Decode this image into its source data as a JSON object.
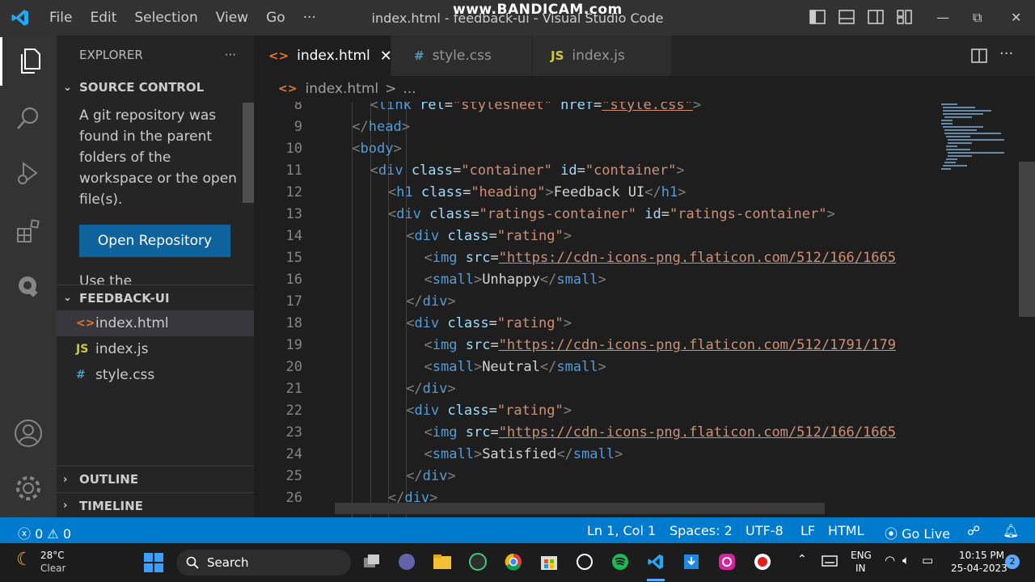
{
  "titlebar": {
    "menu": [
      "File",
      "Edit",
      "Selection",
      "View",
      "Go",
      "···"
    ],
    "title": "index.html - feedback-ui - Visual Studio Code",
    "watermark": "www.BANDICAM.com",
    "maximize": "⧉",
    "minimize": "—",
    "close": "✕"
  },
  "sidebar": {
    "header": "EXPLORER",
    "more": "···",
    "source_control": {
      "title": "SOURCE CONTROL",
      "message": "A git repository was found in the parent folders of the workspace or the open file(s).",
      "button": "Open Repository",
      "more_text": "Use the"
    },
    "folder": {
      "title": "FEEDBACK-UI",
      "files": [
        {
          "icon": "<>",
          "name": "index.html",
          "color": "#e37933"
        },
        {
          "icon": "JS",
          "name": "index.js",
          "color": "#cbcb41"
        },
        {
          "icon": "#",
          "name": "style.css",
          "color": "#519aba"
        }
      ]
    },
    "outline": "OUTLINE",
    "timeline": "TIMELINE"
  },
  "tabs": [
    {
      "icon": "<>",
      "label": "index.html",
      "active": true,
      "color": "#e37933"
    },
    {
      "icon": "#",
      "label": "style.css",
      "active": false,
      "color": "#519aba"
    },
    {
      "icon": "JS",
      "label": "index.js",
      "active": false,
      "color": "#cbcb41"
    }
  ],
  "breadcrumb": {
    "icon": "<>",
    "file": "index.html",
    "sep": ">",
    "rest": "..."
  },
  "code": {
    "lines": [
      {
        "n": "8",
        "indent": 2,
        "parts": [
          [
            "br",
            "<"
          ],
          [
            "tag",
            "link"
          ],
          [
            "txt",
            " "
          ],
          [
            "attr",
            "rel"
          ],
          [
            "txt",
            "="
          ],
          [
            "val",
            "\"stylesheet\""
          ],
          [
            "txt",
            " "
          ],
          [
            "attr",
            "href"
          ],
          [
            "txt",
            "="
          ],
          [
            "url",
            "\"style.css\""
          ],
          [
            "br",
            ">"
          ]
        ]
      },
      {
        "n": "9",
        "indent": 1,
        "parts": [
          [
            "br",
            "</"
          ],
          [
            "tag",
            "head"
          ],
          [
            "br",
            ">"
          ]
        ]
      },
      {
        "n": "10",
        "indent": 1,
        "parts": [
          [
            "br",
            "<"
          ],
          [
            "tag",
            "body"
          ],
          [
            "br",
            ">"
          ]
        ]
      },
      {
        "n": "11",
        "indent": 2,
        "parts": [
          [
            "br",
            "<"
          ],
          [
            "tag",
            "div"
          ],
          [
            "txt",
            " "
          ],
          [
            "attr",
            "class"
          ],
          [
            "txt",
            "="
          ],
          [
            "val",
            "\"container\""
          ],
          [
            "txt",
            " "
          ],
          [
            "attr",
            "id"
          ],
          [
            "txt",
            "="
          ],
          [
            "val",
            "\"container\""
          ],
          [
            "br",
            ">"
          ]
        ]
      },
      {
        "n": "12",
        "indent": 3,
        "parts": [
          [
            "br",
            "<"
          ],
          [
            "tag",
            "h1"
          ],
          [
            "txt",
            " "
          ],
          [
            "attr",
            "class"
          ],
          [
            "txt",
            "="
          ],
          [
            "val",
            "\"heading\""
          ],
          [
            "br",
            ">"
          ],
          [
            "txt",
            "Feedback UI"
          ],
          [
            "br",
            "</"
          ],
          [
            "tag",
            "h1"
          ],
          [
            "br",
            ">"
          ]
        ]
      },
      {
        "n": "13",
        "indent": 3,
        "parts": [
          [
            "br",
            "<"
          ],
          [
            "tag",
            "div"
          ],
          [
            "txt",
            " "
          ],
          [
            "attr",
            "class"
          ],
          [
            "txt",
            "="
          ],
          [
            "val",
            "\"ratings-container\""
          ],
          [
            "txt",
            " "
          ],
          [
            "attr",
            "id"
          ],
          [
            "txt",
            "="
          ],
          [
            "val",
            "\"ratings-container\""
          ],
          [
            "br",
            ">"
          ]
        ]
      },
      {
        "n": "14",
        "indent": 4,
        "parts": [
          [
            "br",
            "<"
          ],
          [
            "tag",
            "div"
          ],
          [
            "txt",
            " "
          ],
          [
            "attr",
            "class"
          ],
          [
            "txt",
            "="
          ],
          [
            "val",
            "\"rating\""
          ],
          [
            "br",
            ">"
          ]
        ]
      },
      {
        "n": "15",
        "indent": 5,
        "parts": [
          [
            "br",
            "<"
          ],
          [
            "tag",
            "img"
          ],
          [
            "txt",
            " "
          ],
          [
            "attr",
            "src"
          ],
          [
            "txt",
            "="
          ],
          [
            "url",
            "\"https://cdn-icons-png.flaticon.com/512/166/1665"
          ]
        ]
      },
      {
        "n": "16",
        "indent": 5,
        "parts": [
          [
            "br",
            "<"
          ],
          [
            "tag",
            "small"
          ],
          [
            "br",
            ">"
          ],
          [
            "txt",
            "Unhappy"
          ],
          [
            "br",
            "</"
          ],
          [
            "tag",
            "small"
          ],
          [
            "br",
            ">"
          ]
        ]
      },
      {
        "n": "17",
        "indent": 4,
        "parts": [
          [
            "br",
            "</"
          ],
          [
            "tag",
            "div"
          ],
          [
            "br",
            ">"
          ]
        ]
      },
      {
        "n": "18",
        "indent": 4,
        "parts": [
          [
            "br",
            "<"
          ],
          [
            "tag",
            "div"
          ],
          [
            "txt",
            " "
          ],
          [
            "attr",
            "class"
          ],
          [
            "txt",
            "="
          ],
          [
            "val",
            "\"rating\""
          ],
          [
            "br",
            ">"
          ]
        ]
      },
      {
        "n": "19",
        "indent": 5,
        "parts": [
          [
            "br",
            "<"
          ],
          [
            "tag",
            "img"
          ],
          [
            "txt",
            " "
          ],
          [
            "attr",
            "src"
          ],
          [
            "txt",
            "="
          ],
          [
            "url",
            "\"https://cdn-icons-png.flaticon.com/512/1791/179"
          ]
        ]
      },
      {
        "n": "20",
        "indent": 5,
        "parts": [
          [
            "br",
            "<"
          ],
          [
            "tag",
            "small"
          ],
          [
            "br",
            ">"
          ],
          [
            "txt",
            "Neutral"
          ],
          [
            "br",
            "</"
          ],
          [
            "tag",
            "small"
          ],
          [
            "br",
            ">"
          ]
        ]
      },
      {
        "n": "21",
        "indent": 4,
        "parts": [
          [
            "br",
            "</"
          ],
          [
            "tag",
            "div"
          ],
          [
            "br",
            ">"
          ]
        ]
      },
      {
        "n": "22",
        "indent": 4,
        "parts": [
          [
            "br",
            "<"
          ],
          [
            "tag",
            "div"
          ],
          [
            "txt",
            " "
          ],
          [
            "attr",
            "class"
          ],
          [
            "txt",
            "="
          ],
          [
            "val",
            "\"rating\""
          ],
          [
            "br",
            ">"
          ]
        ]
      },
      {
        "n": "23",
        "indent": 5,
        "parts": [
          [
            "br",
            "<"
          ],
          [
            "tag",
            "img"
          ],
          [
            "txt",
            " "
          ],
          [
            "attr",
            "src"
          ],
          [
            "txt",
            "="
          ],
          [
            "url",
            "\"https://cdn-icons-png.flaticon.com/512/166/1665"
          ]
        ]
      },
      {
        "n": "24",
        "indent": 5,
        "parts": [
          [
            "br",
            "<"
          ],
          [
            "tag",
            "small"
          ],
          [
            "br",
            ">"
          ],
          [
            "txt",
            "Satisfied"
          ],
          [
            "br",
            "</"
          ],
          [
            "tag",
            "small"
          ],
          [
            "br",
            ">"
          ]
        ]
      },
      {
        "n": "25",
        "indent": 4,
        "parts": [
          [
            "br",
            "</"
          ],
          [
            "tag",
            "div"
          ],
          [
            "br",
            ">"
          ]
        ]
      },
      {
        "n": "26",
        "indent": 3,
        "parts": [
          [
            "br",
            "</"
          ],
          [
            "tag",
            "div"
          ],
          [
            "br",
            ">"
          ]
        ]
      }
    ]
  },
  "statusbar": {
    "errors": "0",
    "warnings": "0",
    "position": "Ln 1, Col 1",
    "spaces": "Spaces: 2",
    "encoding": "UTF-8",
    "eol": "LF",
    "language": "HTML",
    "golive": "Go Live"
  },
  "taskbar": {
    "temp": "28°C",
    "weather": "Clear",
    "search": "Search",
    "lang1": "ENG",
    "lang2": "IN",
    "time": "10:15 PM",
    "date": "25-04-2023",
    "notif": "2"
  }
}
